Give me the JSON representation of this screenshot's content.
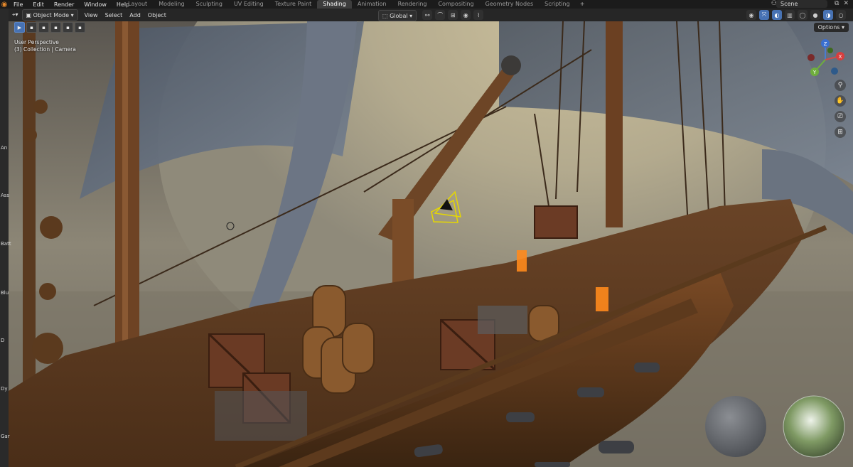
{
  "menubar": {
    "items": [
      "File",
      "Edit",
      "Render",
      "Window",
      "Help"
    ]
  },
  "workspaces": {
    "tabs": [
      "Layout",
      "Modeling",
      "Sculpting",
      "UV Editing",
      "Texture Paint",
      "Shading",
      "Animation",
      "Rendering",
      "Compositing",
      "Geometry Nodes",
      "Scripting"
    ],
    "active": "Shading",
    "add": "+"
  },
  "scene": {
    "name": "Scene"
  },
  "viewport_header": {
    "mode": "Object Mode",
    "menus": [
      "View",
      "Select",
      "Add",
      "Object"
    ],
    "orientation": "Global"
  },
  "options": {
    "label": "Options"
  },
  "overlay": {
    "line1": "User Perspective",
    "line2": "(3) Collection | Camera"
  },
  "left_labels": [
    "An",
    "Ass",
    "Batt",
    "Blu",
    "D",
    "Dy",
    "Gar"
  ],
  "gizmo": {
    "x": "X",
    "y": "Y",
    "z": "Z"
  },
  "colors": {
    "accent": "#4772b3",
    "active_tab": "#3d3d3d",
    "header": "#282828"
  }
}
